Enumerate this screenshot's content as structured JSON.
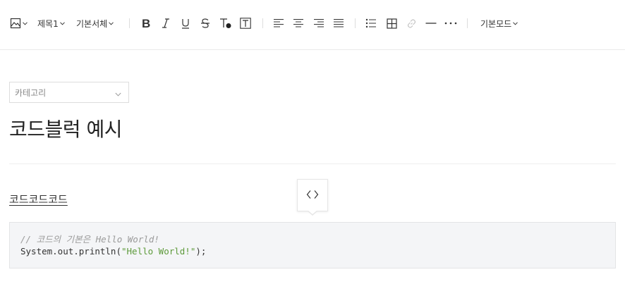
{
  "toolbar": {
    "image_icon": "image-icon",
    "heading_label": "제목1",
    "font_label": "기본서체",
    "mode_label": "기본모드",
    "accent": "#333333"
  },
  "editor": {
    "category_placeholder": "카테고리",
    "title": "코드블럭 예시",
    "body_text": "코드코드코드",
    "code_lines": {
      "comment": "// 코드의 기본은 Hello World!",
      "line2_prefix": "System.out.println(",
      "line2_string": "\"Hello World!\"",
      "line2_suffix": ");"
    },
    "code_string_color": "#5d9a3a",
    "code_comment_color": "#9a9a9a"
  }
}
